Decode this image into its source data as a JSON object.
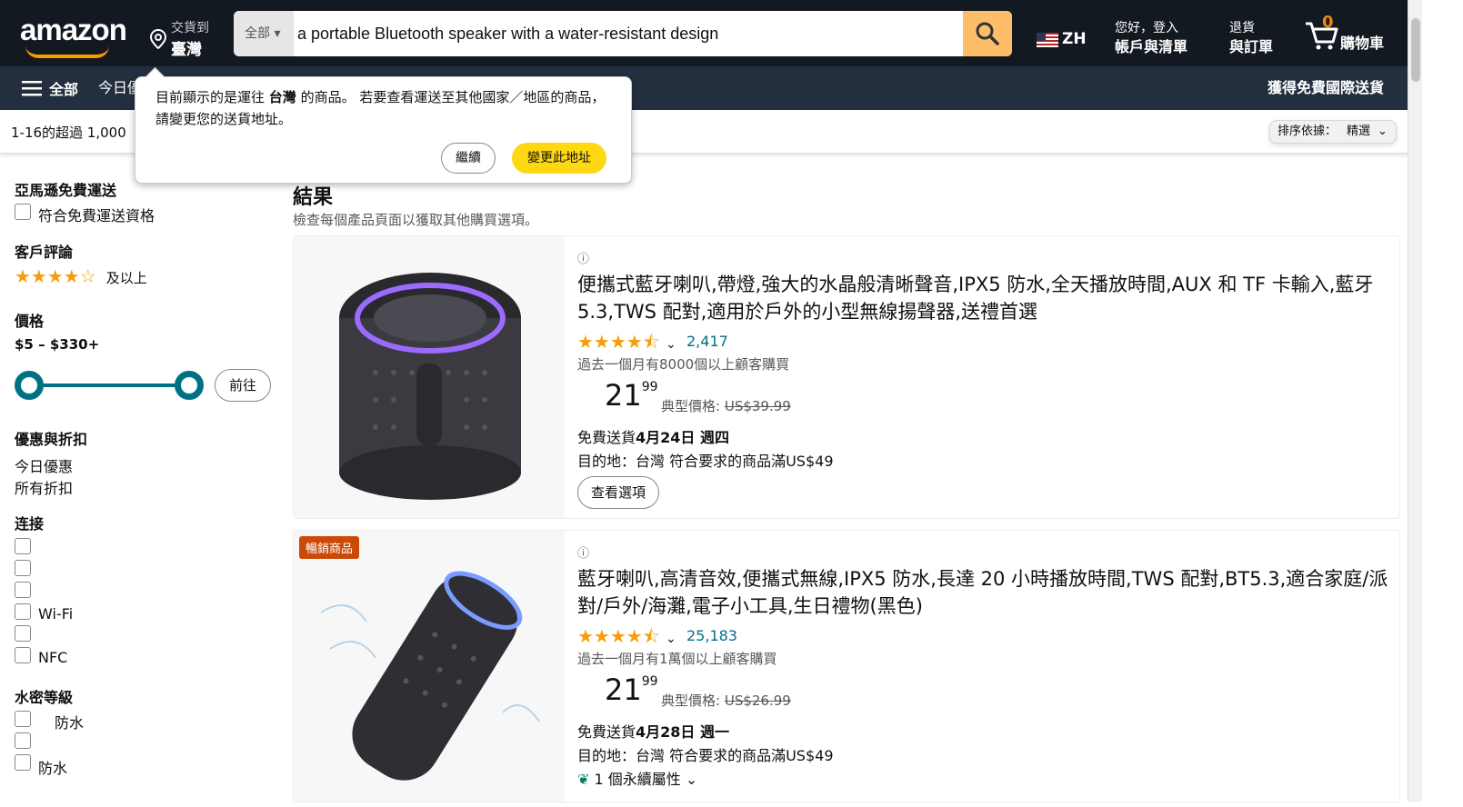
{
  "header": {
    "logo": "amazon",
    "deliver_to": "交貨到",
    "deliver_country": "臺灣",
    "search_category": "全部",
    "search_value": "a portable Bluetooth speaker with a water-resistant design",
    "lang": "ZH",
    "account_l1": "您好，登入",
    "account_l2": "帳戶與清單",
    "orders_l1": "退貨",
    "orders_l2": "與訂單",
    "cart_count": "0",
    "cart_label": "購物車"
  },
  "subnav": {
    "all": "全部",
    "today_deals": "今日優",
    "intl_ship": "獲得免費國際送貨"
  },
  "resultbar": {
    "count": "1-16的超過 1,000",
    "sort_label": "排序依據：",
    "sort_value": "精選"
  },
  "popover": {
    "msg_pre": "目前顯示的是運往 ",
    "msg_bold": "台灣",
    "msg_post": " 的商品。 若要查看運送至其他國家／地區的商品，請變更您的送貨地址。",
    "continue": "繼續",
    "change": "變更此地址"
  },
  "sidebar": {
    "prime_heading": "亞馬遜免費運送",
    "prime_option": "符合免費運送資格",
    "review_heading": "客戶評論",
    "review_and_up": "及以上",
    "price_heading": "價格",
    "price_range": "$5 – $330+",
    "price_go": "前往",
    "deals_heading": "優惠與折扣",
    "deals_1": "今日優惠",
    "deals_2": "所有折扣",
    "conn_heading": "连接",
    "conn_items": [
      "",
      "",
      "",
      "",
      "Wi-Fi",
      "NFC"
    ],
    "water_heading": "水密等級",
    "water_items": [
      "防水",
      "",
      "防水"
    ]
  },
  "main": {
    "title": "結果",
    "subtitle": "檢查每個產品頁面以獲取其他購買選項。",
    "products": [
      {
        "title": "便攜式藍牙喇叭,帶燈,強大的水晶般清晰聲音,IPX5 防水,全天播放時間,AUX 和 TF 卡輸入,藍牙 5.3,TWS 配對,適用於戶外的小型無線揚聲器,送禮首選",
        "rating": 4.5,
        "reviews": "2,417",
        "bought": "過去一個月有8000個以上顧客購買",
        "price_whole": "21",
        "price_frac": "99",
        "typical_label": "典型價格:",
        "typical_price": "US$39.99",
        "ship_pre": "免費送貨",
        "ship_date": "4月24日 週四",
        "dest": "目的地：台灣 符合要求的商品滿US$49",
        "options": "查看選項"
      },
      {
        "badge": "暢銷商品",
        "title": "藍牙喇叭,高清音效,便攜式無線,IPX5 防水,長達 20 小時播放時間,TWS 配對,BT5.3,適合家庭/派對/戶外/海灘,電子小工具,生日禮物(黑色)",
        "rating": 4.5,
        "reviews": "25,183",
        "bought": "過去一個月有1萬個以上顧客購買",
        "price_whole": "21",
        "price_frac": "99",
        "typical_label": "典型價格:",
        "typical_price": "US$26.99",
        "ship_pre": "免費送貨",
        "ship_date": "4月28日 週一",
        "dest": "目的地：台灣 符合要求的商品滿US$49",
        "extra": "1 個永續屬性"
      }
    ]
  },
  "colors": {
    "nav_dark": "#131921",
    "nav_sub": "#232f3e",
    "accent": "#febd69",
    "button_yellow": "#ffd814",
    "link": "#007185",
    "star": "#f59e0b",
    "badge": "#cc4a08"
  }
}
